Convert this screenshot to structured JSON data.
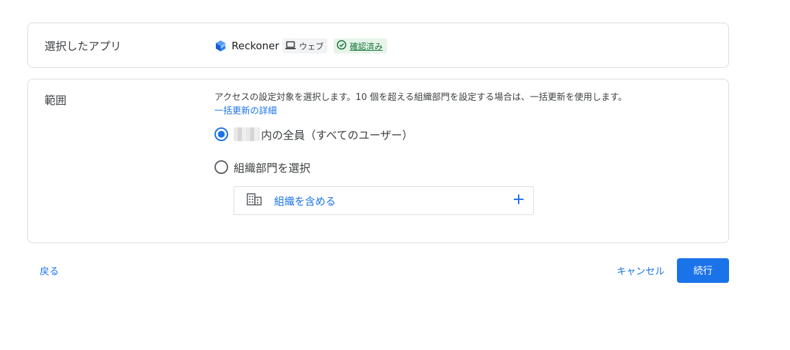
{
  "app_section": {
    "label": "選択したアプリ",
    "app_name": "Reckoner",
    "platform_chip": "ウェブ",
    "verified_chip": "確認済み",
    "logo_icon": "reckoner-logo-icon",
    "platform_icon": "laptop-icon",
    "verified_icon": "check-circle-icon"
  },
  "scope_section": {
    "label": "範囲",
    "description": "アクセスの設定対象を選択します。10 個を超える組織部門を設定する場合は、一括更新を使用します。",
    "learn_more": "一括更新の詳細",
    "options": [
      {
        "label": "内の全員（すべてのユーザー）",
        "selected": true
      },
      {
        "label": "組織部門を選択",
        "selected": false
      }
    ],
    "include_org": {
      "label": "組織を含める",
      "icon": "building-icon",
      "action_icon": "plus-icon"
    }
  },
  "footer": {
    "back": "戻る",
    "cancel": "キャンセル",
    "continue": "続行"
  },
  "colors": {
    "accent": "#1a73e8",
    "verified_bg": "#e6f4ea",
    "verified_fg": "#137333",
    "border": "#dadce0"
  }
}
